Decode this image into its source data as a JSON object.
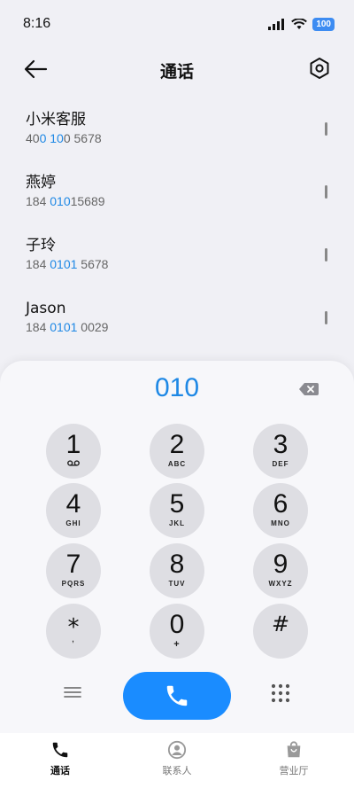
{
  "status_bar": {
    "time": "8:16",
    "battery": "100"
  },
  "header": {
    "title": "通话"
  },
  "contacts": [
    {
      "name": "小米客服",
      "number_parts": [
        "40",
        "0",
        " ",
        "10",
        "0 5678"
      ],
      "highlight": [
        false,
        true,
        false,
        true,
        false
      ]
    },
    {
      "name": "燕婷",
      "number_parts": [
        "184 ",
        "010",
        "15689"
      ],
      "highlight": [
        false,
        true,
        false
      ]
    },
    {
      "name": "子玲",
      "number_parts": [
        "184 ",
        "0101",
        " 5678"
      ],
      "highlight": [
        false,
        true,
        false
      ]
    },
    {
      "name": "Jason",
      "number_parts": [
        "184 ",
        "0101",
        " 0029"
      ],
      "highlight": [
        false,
        true,
        false
      ]
    }
  ],
  "dialpad": {
    "input": "010",
    "keys": [
      {
        "digit": "1",
        "letters": ""
      },
      {
        "digit": "2",
        "letters": "ABC"
      },
      {
        "digit": "3",
        "letters": "DEF"
      },
      {
        "digit": "4",
        "letters": "GHI"
      },
      {
        "digit": "5",
        "letters": "JKL"
      },
      {
        "digit": "6",
        "letters": "MNO"
      },
      {
        "digit": "7",
        "letters": "PQRS"
      },
      {
        "digit": "8",
        "letters": "TUV"
      },
      {
        "digit": "9",
        "letters": "WXYZ"
      },
      {
        "digit": "*",
        "letters": ","
      },
      {
        "digit": "0",
        "letters": "+"
      },
      {
        "digit": "#",
        "letters": ""
      }
    ]
  },
  "bottom_nav": [
    {
      "label": "通话",
      "icon": "phone-icon",
      "active": true
    },
    {
      "label": "联系人",
      "icon": "contact-person-icon",
      "active": false
    },
    {
      "label": "营业厅",
      "icon": "shopping-bag-icon",
      "active": false
    }
  ],
  "colors": {
    "accent": "#1e88e5",
    "call_button": "#1a8cff",
    "battery": "#3d8cf2"
  }
}
